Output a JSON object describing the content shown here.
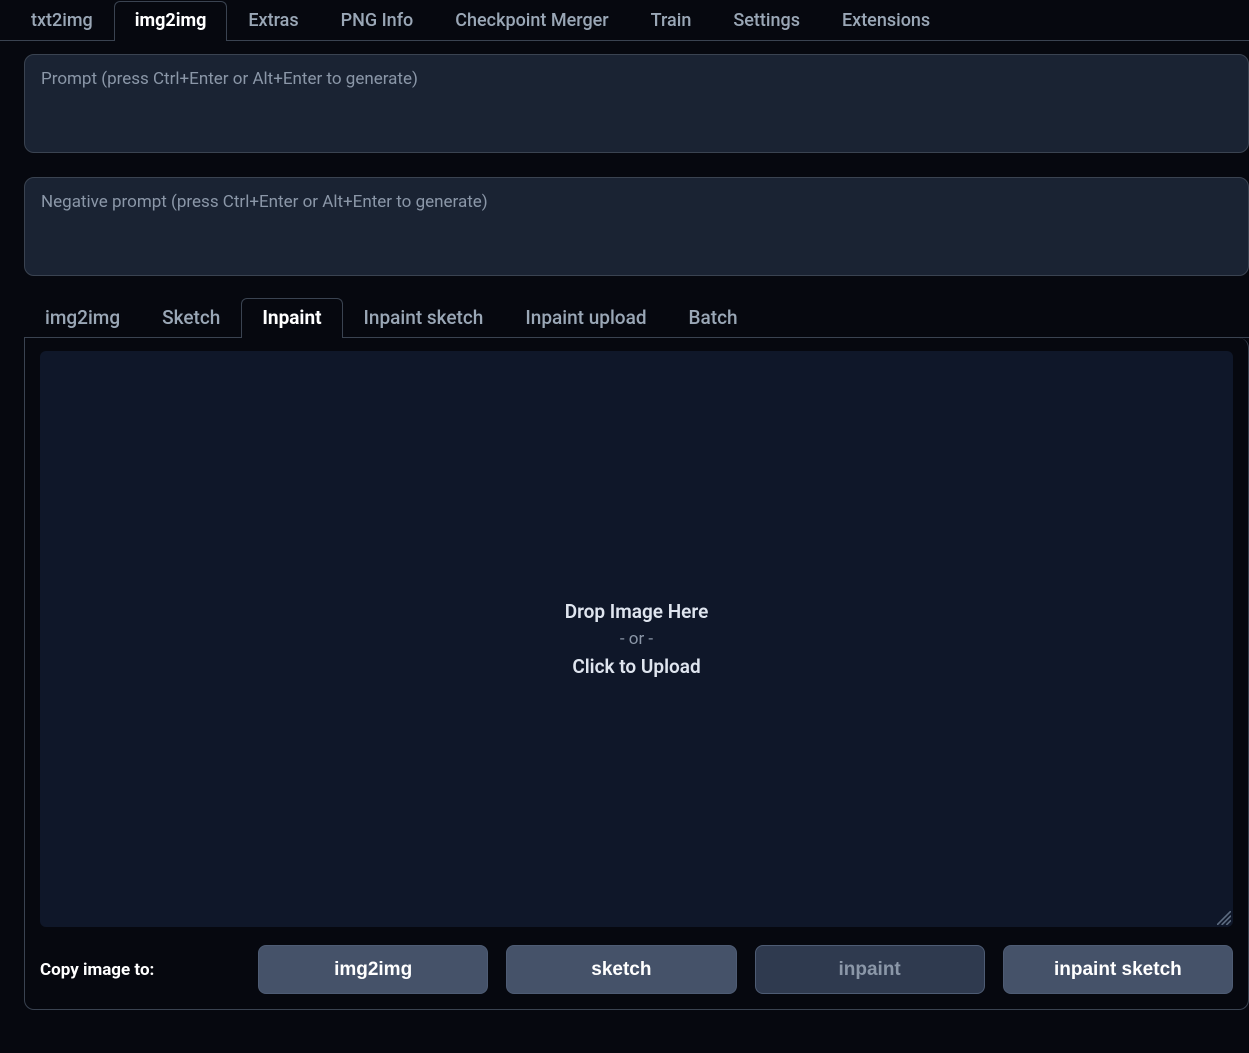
{
  "top_tabs": {
    "txt2img": "txt2img",
    "img2img": "img2img",
    "extras": "Extras",
    "pnginfo": "PNG Info",
    "ckptmerge": "Checkpoint Merger",
    "train": "Train",
    "settings": "Settings",
    "extensions": "Extensions",
    "active": "img2img"
  },
  "prompt": {
    "main_placeholder": "Prompt (press Ctrl+Enter or Alt+Enter to generate)",
    "main_value": "",
    "neg_placeholder": "Negative prompt (press Ctrl+Enter or Alt+Enter to generate)",
    "neg_value": ""
  },
  "sub_tabs": {
    "img2img": "img2img",
    "sketch": "Sketch",
    "inpaint": "Inpaint",
    "inpaint_sketch": "Inpaint sketch",
    "inpaint_upload": "Inpaint upload",
    "batch": "Batch",
    "active": "inpaint"
  },
  "dropzone": {
    "line1": "Drop Image Here",
    "line2": "- or -",
    "line3": "Click to Upload"
  },
  "copy_row": {
    "label": "Copy image to:",
    "img2img": "img2img",
    "sketch": "sketch",
    "inpaint": "inpaint",
    "inpaint_sketch": "inpaint sketch",
    "disabled": "inpaint"
  }
}
